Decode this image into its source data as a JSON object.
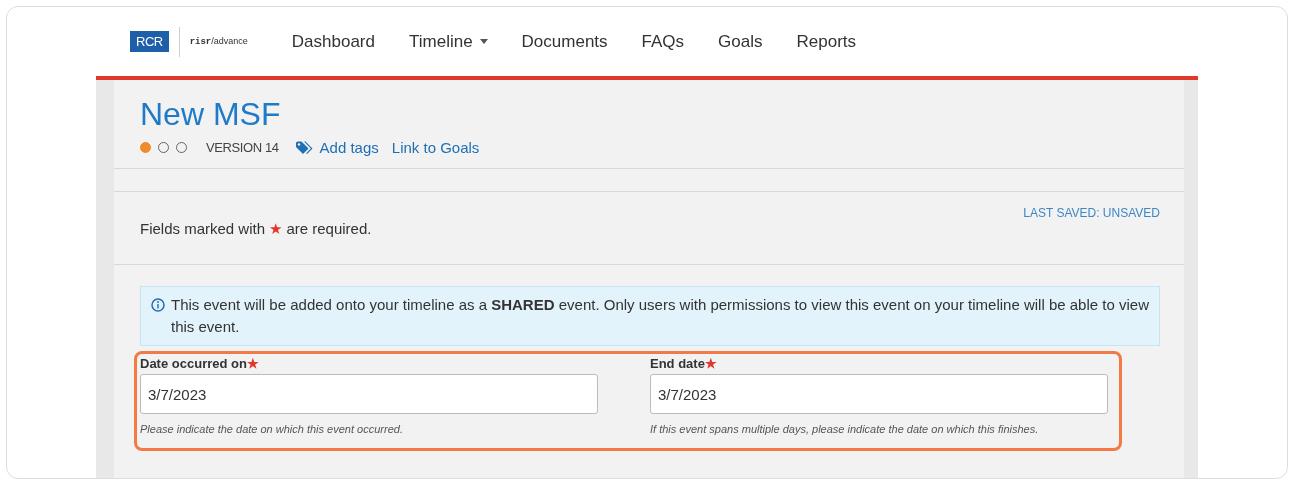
{
  "header": {
    "logo_text": "RCR",
    "product_brand": "risr",
    "product_name": "/advance",
    "nav": [
      {
        "label": "Dashboard",
        "dropdown": false
      },
      {
        "label": "Timeline",
        "dropdown": true
      },
      {
        "label": "Documents",
        "dropdown": false
      },
      {
        "label": "FAQs",
        "dropdown": false
      },
      {
        "label": "Goals",
        "dropdown": false
      },
      {
        "label": "Reports",
        "dropdown": false
      }
    ]
  },
  "page": {
    "title": "New MSF",
    "steps": [
      {
        "done": true
      },
      {
        "done": false
      },
      {
        "done": false
      }
    ],
    "required_mark": "★",
    "version": "VERSION 14",
    "add_tags": "Add tags",
    "link_goals": "Link to Goals",
    "required_note": {
      "before": "Fields marked with",
      "after": "are required."
    },
    "last_saved": "LAST SAVED: UNSAVED",
    "info": "This event will be added onto your timeline as a **SHARED** event. Only users with permissions to view this event on your timeline will be able to view this event.",
    "fields_highlighted": true,
    "fields": [
      {
        "label": "Date occurred on",
        "required": true,
        "value": "3/7/2023",
        "hint": "Please indicate the date on which this event occurred."
      },
      {
        "label": "End date",
        "required": true,
        "value": "3/7/2023",
        "hint": "If this event spans multiple days, please indicate the date on which this finishes."
      }
    ]
  }
}
